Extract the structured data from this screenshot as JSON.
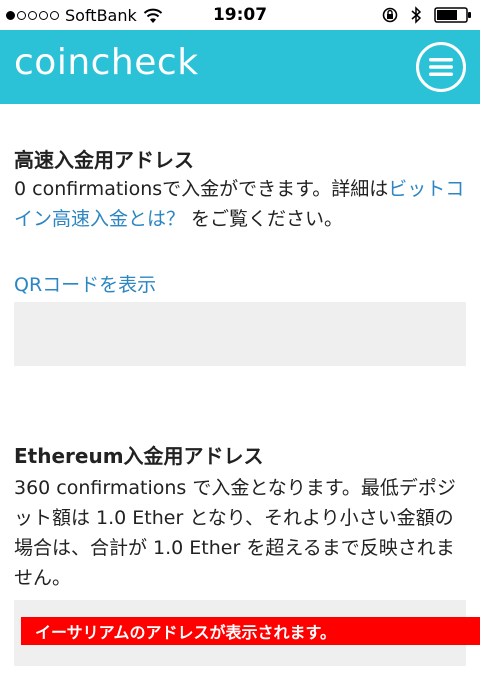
{
  "status_bar": {
    "carrier": "SoftBank",
    "time": "19:07",
    "signal_icon": "signal-dots-icon",
    "wifi_icon": "wifi-icon",
    "battery_icon": "battery-icon"
  },
  "header": {
    "logo": "coincheck",
    "bg_color": "#2bc2d8",
    "menu_icon": "hamburger-menu-icon"
  },
  "fast_deposit": {
    "title": "高速入金用アドレス",
    "desc_prefix": "0 confirmationsで入金ができます。詳細は",
    "link_text": "ビットコイン高速入金とは？",
    "desc_suffix": " をご覧ください。",
    "qr_link": "QRコードを表示"
  },
  "ethereum_deposit": {
    "title": "Ethereum入金用アドレス",
    "desc": "360 confirmations で入金となります。最低デポジット額は 1.0 Ether となり、それより小さい金額の場合は、合計が 1.0 Ether を超えるまで反映されません。",
    "address_banner": "イーサリアムのアドレスが表示されます。"
  },
  "colors": {
    "link": "#2b86c2",
    "address_box": "#efefef",
    "banner": "#ff0000"
  }
}
